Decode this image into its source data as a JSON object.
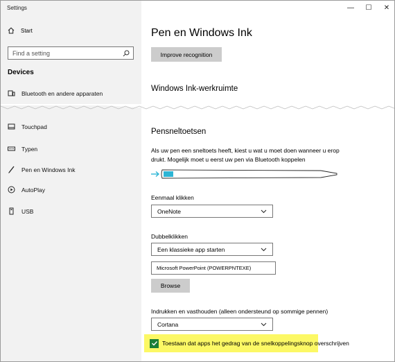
{
  "window": {
    "title": "Settings",
    "minimize": "—",
    "maximize": "☐",
    "close": "✕"
  },
  "sidebar": {
    "home_label": "Start",
    "search_placeholder": "Find a setting",
    "section": "Devices",
    "items": [
      {
        "label": "Bluetooth en andere apparaten",
        "icon": "bluetooth-devices-icon"
      },
      {
        "label": "Touchpad",
        "icon": "touchpad-icon"
      },
      {
        "label": "Typen",
        "icon": "keyboard-icon"
      },
      {
        "label": "Pen en Windows Ink",
        "icon": "pen-icon",
        "active": true
      },
      {
        "label": "AutoPlay",
        "icon": "autoplay-icon"
      },
      {
        "label": "USB",
        "icon": "usb-icon"
      }
    ]
  },
  "main": {
    "title": "Pen en Windows Ink",
    "improve_button": "Improve recognition",
    "workspace_heading": "Windows Ink-werkruimte",
    "shortcuts_heading": "Pensneltoetsen",
    "description": "Als uw pen een sneltoets heeft, kiest u wat u moet doen wanneer u erop drukt. Mogelijk moet u eerst uw pen via Bluetooth koppelen",
    "single_click": {
      "label": "Eenmaal klikken",
      "value": "OneNote"
    },
    "double_click": {
      "label": "Dubbelklikken",
      "value": "Een klassieke app starten",
      "path": "Microsoft  PowerPoint (POWERPNTEXE)",
      "browse": "Browse"
    },
    "press_hold": {
      "label": "Indrukken en vasthouden (alleen ondersteund op sommige pennen)",
      "value": "Cortana"
    },
    "allow_override": {
      "label": "Toestaan dat apps het gedrag van de snelkoppelingsknop overschrijven",
      "checked": true
    }
  },
  "colors": {
    "accent": "#1a7f37",
    "highlight": "#fcf865",
    "pen_cyan": "#2db5d5"
  }
}
